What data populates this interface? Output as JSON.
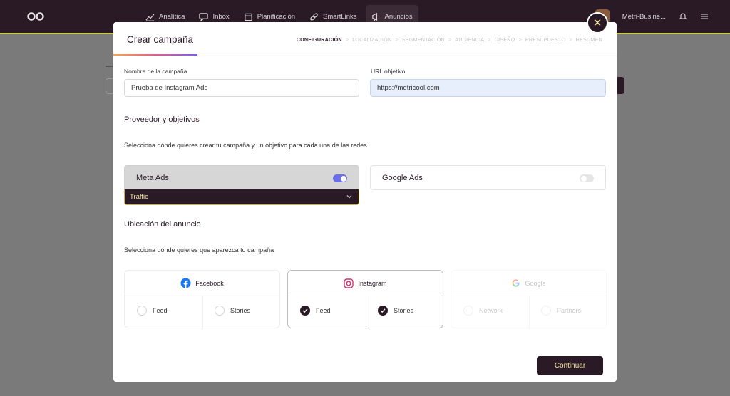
{
  "nav": {
    "items": [
      {
        "label": "Analítica",
        "icon": "analytics-icon"
      },
      {
        "label": "Inbox",
        "icon": "inbox-icon"
      },
      {
        "label": "Planificación",
        "icon": "calendar-icon"
      },
      {
        "label": "SmartLinks",
        "icon": "link-icon"
      },
      {
        "label": "Anuncios",
        "icon": "megaphone-icon"
      }
    ],
    "account": "Metri-Busine...",
    "brand_color": "#c8c84a"
  },
  "modal": {
    "title": "Crear campaña",
    "steps": [
      "CONFIGURACIÓN",
      "LOCALIZACIÓN",
      "SEGMENTACIÓN",
      "AUDIENCIA",
      "DISEÑO",
      "PRESUPUESTO",
      "RESUMEN"
    ],
    "close_label": "✕",
    "campaign_name": {
      "label": "Nombre de la campaña",
      "value": "Prueba de Instagram Ads"
    },
    "target_url": {
      "label": "URL objetivo",
      "value": "https://metricool.com"
    },
    "provider_section": {
      "title": "Proveedor y objetivos",
      "description": "Selecciona dónde quieres crear tu campaña y un objetivo para cada una de las redes"
    },
    "providers": [
      {
        "name": "Meta Ads",
        "enabled": true,
        "objective": "Traffic"
      },
      {
        "name": "Google Ads",
        "enabled": false
      }
    ],
    "placement_section": {
      "title": "Ubicación del anuncio",
      "description": "Selecciona dónde quieres que aparezca tu campaña"
    },
    "placements": {
      "facebook": {
        "name": "Facebook",
        "options": [
          {
            "label": "Feed",
            "checked": false
          },
          {
            "label": "Stories",
            "checked": false
          }
        ]
      },
      "instagram": {
        "name": "Instagram",
        "options": [
          {
            "label": "Feed",
            "checked": true
          },
          {
            "label": "Stories",
            "checked": true
          }
        ]
      },
      "google": {
        "name": "Google",
        "options": [
          {
            "label": "Network",
            "checked": false
          },
          {
            "label": "Partners",
            "checked": false
          }
        ]
      }
    },
    "continue_label": "Continuar"
  },
  "colors": {
    "accent_dark": "#2a1a26",
    "accent_yellow": "#f2e8a0",
    "toggle_on": "#6b6ee8"
  }
}
